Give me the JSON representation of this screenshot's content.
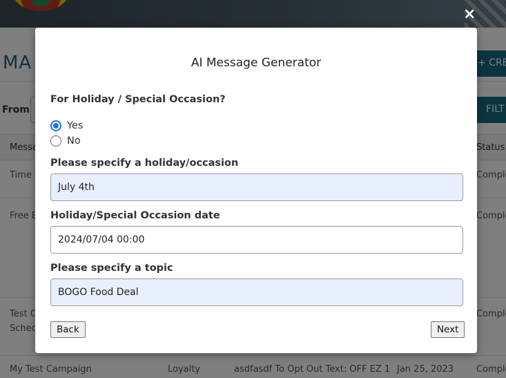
{
  "background": {
    "page_title": "MA",
    "create_button": "+ CRE",
    "filter_button": "FILT",
    "from_label": "From",
    "table": {
      "col_message": "Messa",
      "col_status": "Status",
      "rows": [
        {
          "name": "Time T",
          "status": "Comple"
        },
        {
          "name": "Free B",
          "status": "Comple"
        },
        {
          "name": "Test C",
          "name2": "Sched",
          "status": "Comple"
        },
        {
          "name": "My Test Campaign",
          "type": "Loyalty",
          "text": "asdfasdf To Opt Out Text: OFF EZ 1",
          "date": "Jan 25, 2023",
          "status": "Comple"
        }
      ]
    }
  },
  "modal": {
    "close_icon": "×",
    "title": "AI Message Generator",
    "question": "For Holiday / Special Occasion?",
    "options": [
      {
        "label": "Yes",
        "selected": true
      },
      {
        "label": "No",
        "selected": false
      }
    ],
    "occasion": {
      "label": "Please specify a holiday/occasion",
      "value": "July 4th"
    },
    "date": {
      "label": "Holiday/Special Occasion date",
      "value": "2024/07/04 00:00"
    },
    "topic": {
      "label": "Please specify a topic",
      "value": "BOGO Food Deal"
    },
    "back_label": "Back",
    "next_label": "Next"
  },
  "colors": {
    "accent": "#1a73e8",
    "brand_teal": "#176b82",
    "filled_input": "#e8f0fe"
  }
}
